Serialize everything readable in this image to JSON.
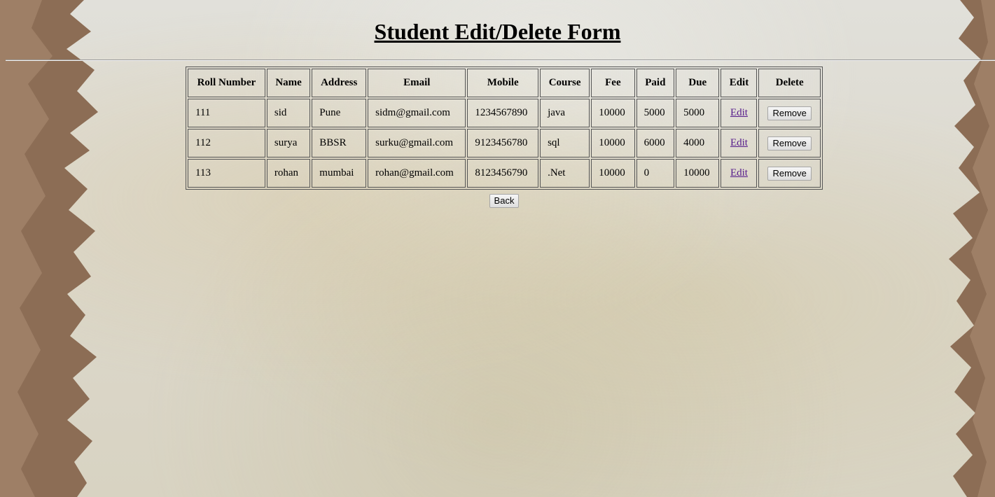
{
  "page": {
    "title": "Student Edit/Delete Form"
  },
  "table": {
    "headers": {
      "roll_number": "Roll Number",
      "name": "Name",
      "address": "Address",
      "email": "Email",
      "mobile": "Mobile",
      "course": "Course",
      "fee": "Fee",
      "paid": "Paid",
      "due": "Due",
      "edit": "Edit",
      "delete": "Delete"
    },
    "rows": [
      {
        "roll": "111",
        "name": "sid",
        "address": "Pune",
        "email": "sidm@gmail.com",
        "mobile": "1234567890",
        "course": "java",
        "fee": "10000",
        "paid": "5000",
        "due": "5000",
        "edit_label": "Edit",
        "remove_label": "Remove"
      },
      {
        "roll": "112",
        "name": "surya",
        "address": "BBSR",
        "email": "surku@gmail.com",
        "mobile": "9123456780",
        "course": "sql",
        "fee": "10000",
        "paid": "6000",
        "due": "4000",
        "edit_label": "Edit",
        "remove_label": "Remove"
      },
      {
        "roll": "113",
        "name": "rohan",
        "address": "mumbai",
        "email": "rohan@gmail.com",
        "mobile": "8123456790",
        "course": ".Net",
        "fee": "10000",
        "paid": "0",
        "due": "10000",
        "edit_label": "Edit",
        "remove_label": "Remove"
      }
    ]
  },
  "actions": {
    "back_label": "Back"
  },
  "colors": {
    "background": "#dedbd0",
    "border_edge": "#8c6d55",
    "visited_link": "#551a8b"
  }
}
